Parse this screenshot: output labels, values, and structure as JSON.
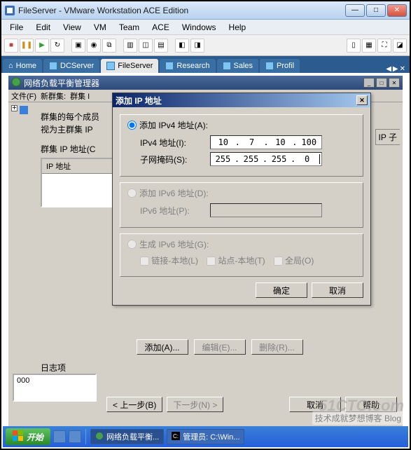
{
  "window": {
    "title": "FileServer - VMware Workstation ACE Edition"
  },
  "menu": [
    "File",
    "Edit",
    "View",
    "VM",
    "Team",
    "ACE",
    "Windows",
    "Help"
  ],
  "tabs": {
    "home": "Home",
    "items": [
      "DCServer",
      "FileServer",
      "Research",
      "Sales",
      "Profil"
    ],
    "active": "FileServer"
  },
  "nlb": {
    "title": "网络负载平衡管理器",
    "menu_file": "文件(F)",
    "menu_cluster_new": "新群集:",
    "menu_cluster": "群集 I",
    "info1": "群集的每个成员",
    "info2": "视为主群集 IP",
    "cluster_ip_label": "群集 IP 地址(C",
    "col_ip": "IP 地址",
    "right_col": "IP 子",
    "log_label": "日志项",
    "log_row": "000",
    "btn_add": "添加(A)...",
    "btn_edit": "编辑(E)...",
    "btn_delete": "删除(R)...",
    "btn_back": "< 上一步(B)",
    "btn_next": "下一步(N) >",
    "btn_cancel": "取消",
    "btn_help": "帮助"
  },
  "dialog": {
    "title": "添加 IP 地址",
    "rb_ipv4": "添加 IPv4 地址(A):",
    "lbl_ipv4": "IPv4 地址(I):",
    "ipv4": [
      "10",
      "7",
      "10",
      "100"
    ],
    "lbl_mask": "子网掩码(S):",
    "mask": [
      "255",
      "255",
      "255",
      "0"
    ],
    "rb_ipv6": "添加 IPv6 地址(D):",
    "lbl_ipv6": "IPv6 地址(P):",
    "rb_gen": "生成 IPv6 地址(G):",
    "chk_link": "链接-本地(L)",
    "chk_site": "站点-本地(T)",
    "chk_global": "全局(O)",
    "btn_ok": "确定",
    "btn_cancel": "取消"
  },
  "taskbar": {
    "start": "开始",
    "task1": "网络负载平衡...",
    "task2": "管理员: C:\\Win..."
  },
  "watermark": {
    "big": "51CTO.com",
    "small": "技术成就梦想博客 Blog"
  }
}
